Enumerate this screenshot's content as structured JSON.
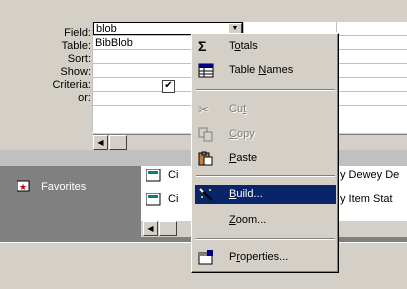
{
  "qbe": {
    "row_labels": [
      "Field:",
      "Table:",
      "Sort:",
      "Show:",
      "Criteria:",
      "or:"
    ],
    "field_value": "blob",
    "table_value": "BibBlob",
    "show_checked": "✔"
  },
  "database_window": {
    "favorites_label": "Favorites",
    "list_items": [
      "Ci",
      "Ci"
    ],
    "partial_texts": [
      "y Dewey De",
      "y Item Stat"
    ]
  },
  "context_menu": {
    "items": [
      {
        "label": "Totals",
        "accel": "o",
        "icon": "sigma-icon",
        "state": "normal"
      },
      {
        "label": "Table Names",
        "accel": "N",
        "icon": "table-names-icon",
        "state": "normal"
      },
      {
        "label": "Cut",
        "accel": "t",
        "icon": "scissors-icon",
        "state": "disabled"
      },
      {
        "label": "Copy",
        "accel": "C",
        "icon": "copy-icon",
        "state": "disabled"
      },
      {
        "label": "Paste",
        "accel": "P",
        "icon": "paste-icon",
        "state": "normal"
      },
      {
        "label": "Build...",
        "accel": "B",
        "icon": "build-wand-icon",
        "state": "selected"
      },
      {
        "label": "Zoom...",
        "accel": "Z",
        "icon": "",
        "state": "normal"
      },
      {
        "label": "Properties...",
        "accel": "r",
        "icon": "properties-icon",
        "state": "normal"
      }
    ]
  },
  "colors": {
    "face": "#d4d0c8",
    "highlight": "#0a246a",
    "db_background": "#808080"
  }
}
